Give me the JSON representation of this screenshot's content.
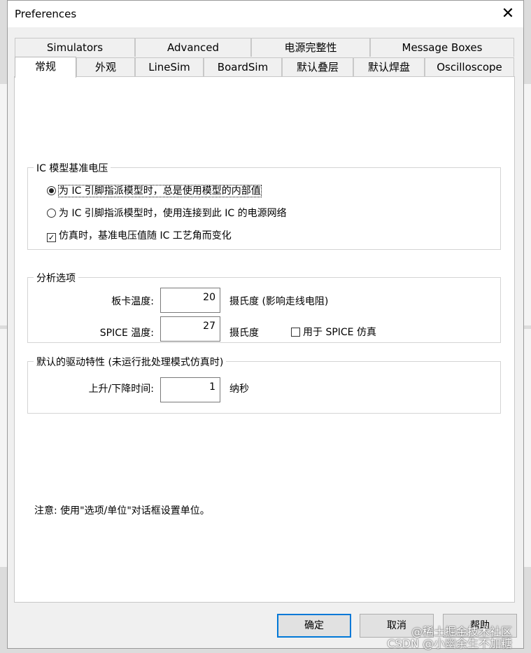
{
  "window": {
    "title": "Preferences",
    "close_glyph": "✕"
  },
  "tabs_back": [
    "Simulators",
    "Advanced",
    "电源完整性",
    "Message Boxes"
  ],
  "tabs_front": [
    "常规",
    "外观",
    "LineSim",
    "BoardSim",
    "默认叠层",
    "默认焊盘",
    "Oscilloscope"
  ],
  "active_tab": "常规",
  "ic_group": {
    "title": "IC 模型基准电压",
    "radio1": "为 IC 引脚指派模型时，总是使用模型的内部值",
    "radio2": "为 IC 引脚指派模型时，使用连接到此 IC 的电源网络",
    "checkbox": "仿真时，基准电压值随 IC 工艺角而变化",
    "check_glyph": "✓"
  },
  "analysis_group": {
    "title": "分析选项",
    "board_temp_label": "板卡温度:",
    "board_temp_value": "20",
    "board_temp_unit": "摄氏度 (影响走线电阻)",
    "spice_temp_label": "SPICE 温度:",
    "spice_temp_value": "27",
    "spice_temp_unit": "摄氏度",
    "spice_checkbox": "用于 SPICE 仿真"
  },
  "driver_group": {
    "title": "默认的驱动特性 (未运行批处理模式仿真时)",
    "rise_fall_label": "上升/下降时间:",
    "rise_fall_value": "1",
    "rise_fall_unit": "纳秒"
  },
  "note": "注意: 使用\"选项/单位\"对话框设置单位。",
  "buttons": {
    "ok": "确定",
    "cancel": "取消",
    "help": "帮助"
  },
  "watermarks": [
    "@稀土掘金技术社区",
    "CSDN @小幽余生不加糖"
  ]
}
